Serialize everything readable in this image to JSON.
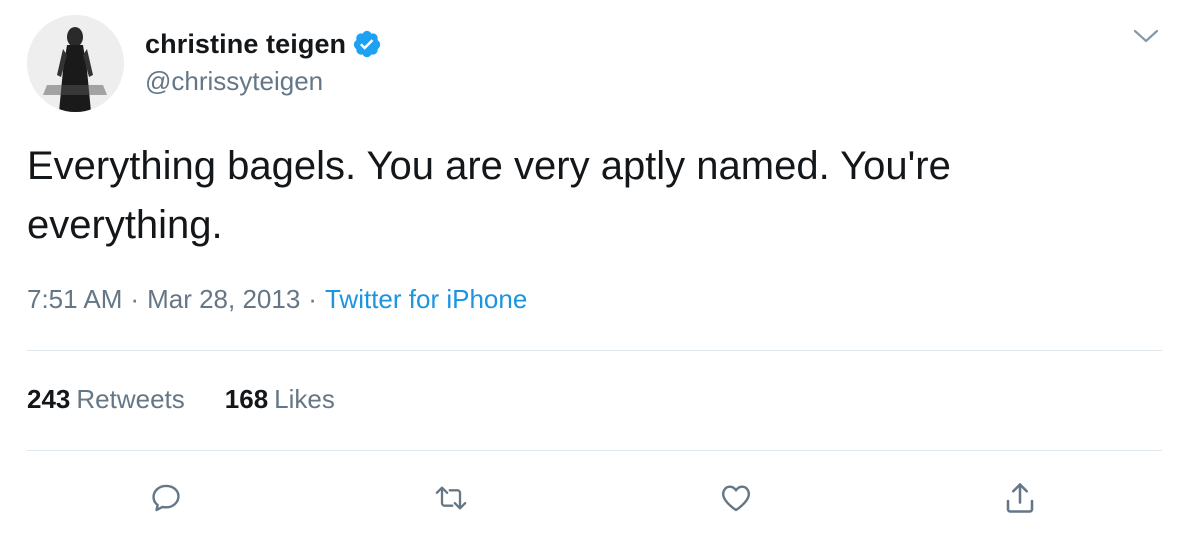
{
  "user": {
    "display_name": "christine teigen",
    "handle": "@chrissyteigen",
    "verified": true
  },
  "tweet": {
    "text": "Everything bagels. You are very aptly named. You're everything.",
    "time": "7:51 AM",
    "separator": "·",
    "date": "Mar 28, 2013",
    "source": "Twitter for iPhone"
  },
  "stats": {
    "retweets_count": "243",
    "retweets_label": "Retweets",
    "likes_count": "168",
    "likes_label": "Likes"
  },
  "icons": {
    "verified": "verified-badge-icon",
    "menu": "chevron-down-icon",
    "reply": "reply-icon",
    "retweet": "retweet-icon",
    "like": "heart-icon",
    "share": "share-icon"
  },
  "colors": {
    "text": "#14171a",
    "secondary": "#657786",
    "accent": "#1b95e0",
    "divider": "#e1e8ed"
  }
}
